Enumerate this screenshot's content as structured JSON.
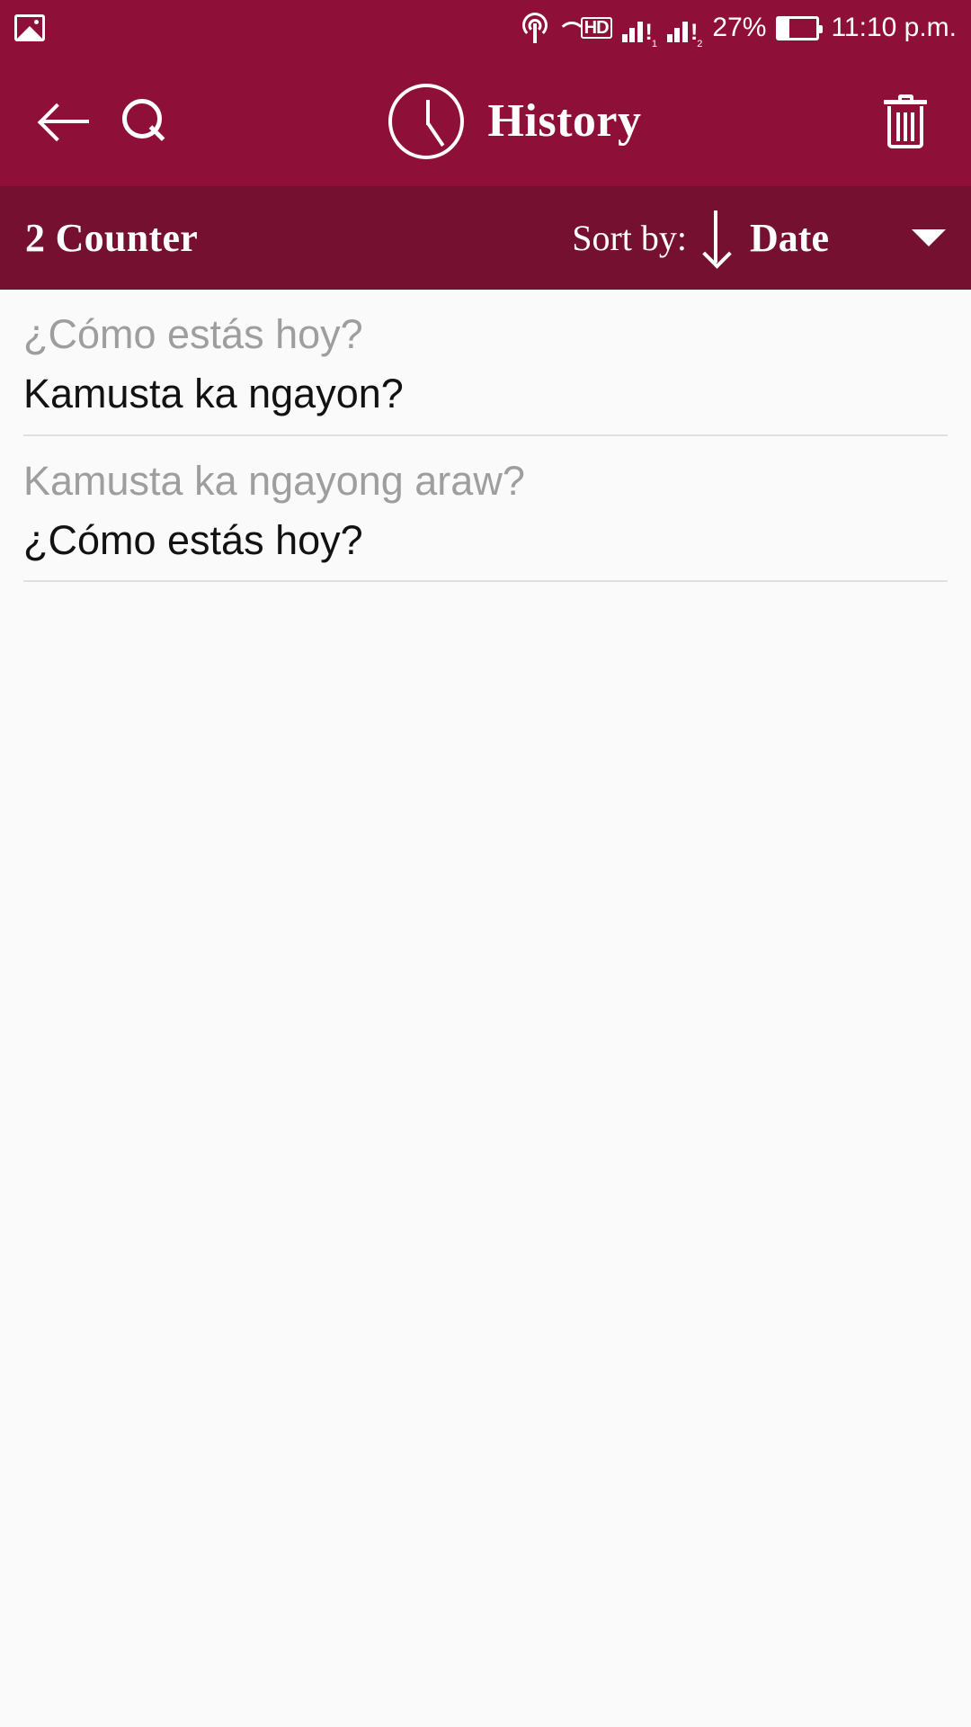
{
  "status_bar": {
    "gallery_icon": "gallery-icon",
    "cast_icon": "cast-icon",
    "hd_voice_icon": "hd-voice-icon",
    "signal_sim1": {
      "icon": "signal-icon",
      "sim": "1",
      "alert": "!"
    },
    "signal_sim2": {
      "icon": "signal-icon",
      "sim": "2",
      "alert": "!"
    },
    "battery_percent": "27%",
    "battery_level": 27,
    "time": "11:10 p.m."
  },
  "app_bar": {
    "back_icon": "back-arrow-icon",
    "search_icon": "search-icon",
    "clock_icon": "clock-icon",
    "title": "History",
    "delete_icon": "trash-icon"
  },
  "sort_bar": {
    "counter": "2 Counter",
    "sort_by_label": "Sort by:",
    "sort_direction_icon": "arrow-down-icon",
    "sort_value": "Date",
    "dropdown_icon": "caret-down-icon"
  },
  "history": {
    "items": [
      {
        "source": "¿Cómo estás hoy?",
        "target": "Kamusta ka ngayon?"
      },
      {
        "source": "Kamusta ka ngayong araw?",
        "target": "¿Cómo estás hoy?"
      }
    ]
  },
  "colors": {
    "primary": "#8e1038",
    "primary_dark": "#751031",
    "background": "#fafafa",
    "text_primary": "#121212",
    "text_secondary": "#9e9e9e",
    "divider": "#e0e0e0",
    "on_primary": "#ffffff"
  }
}
